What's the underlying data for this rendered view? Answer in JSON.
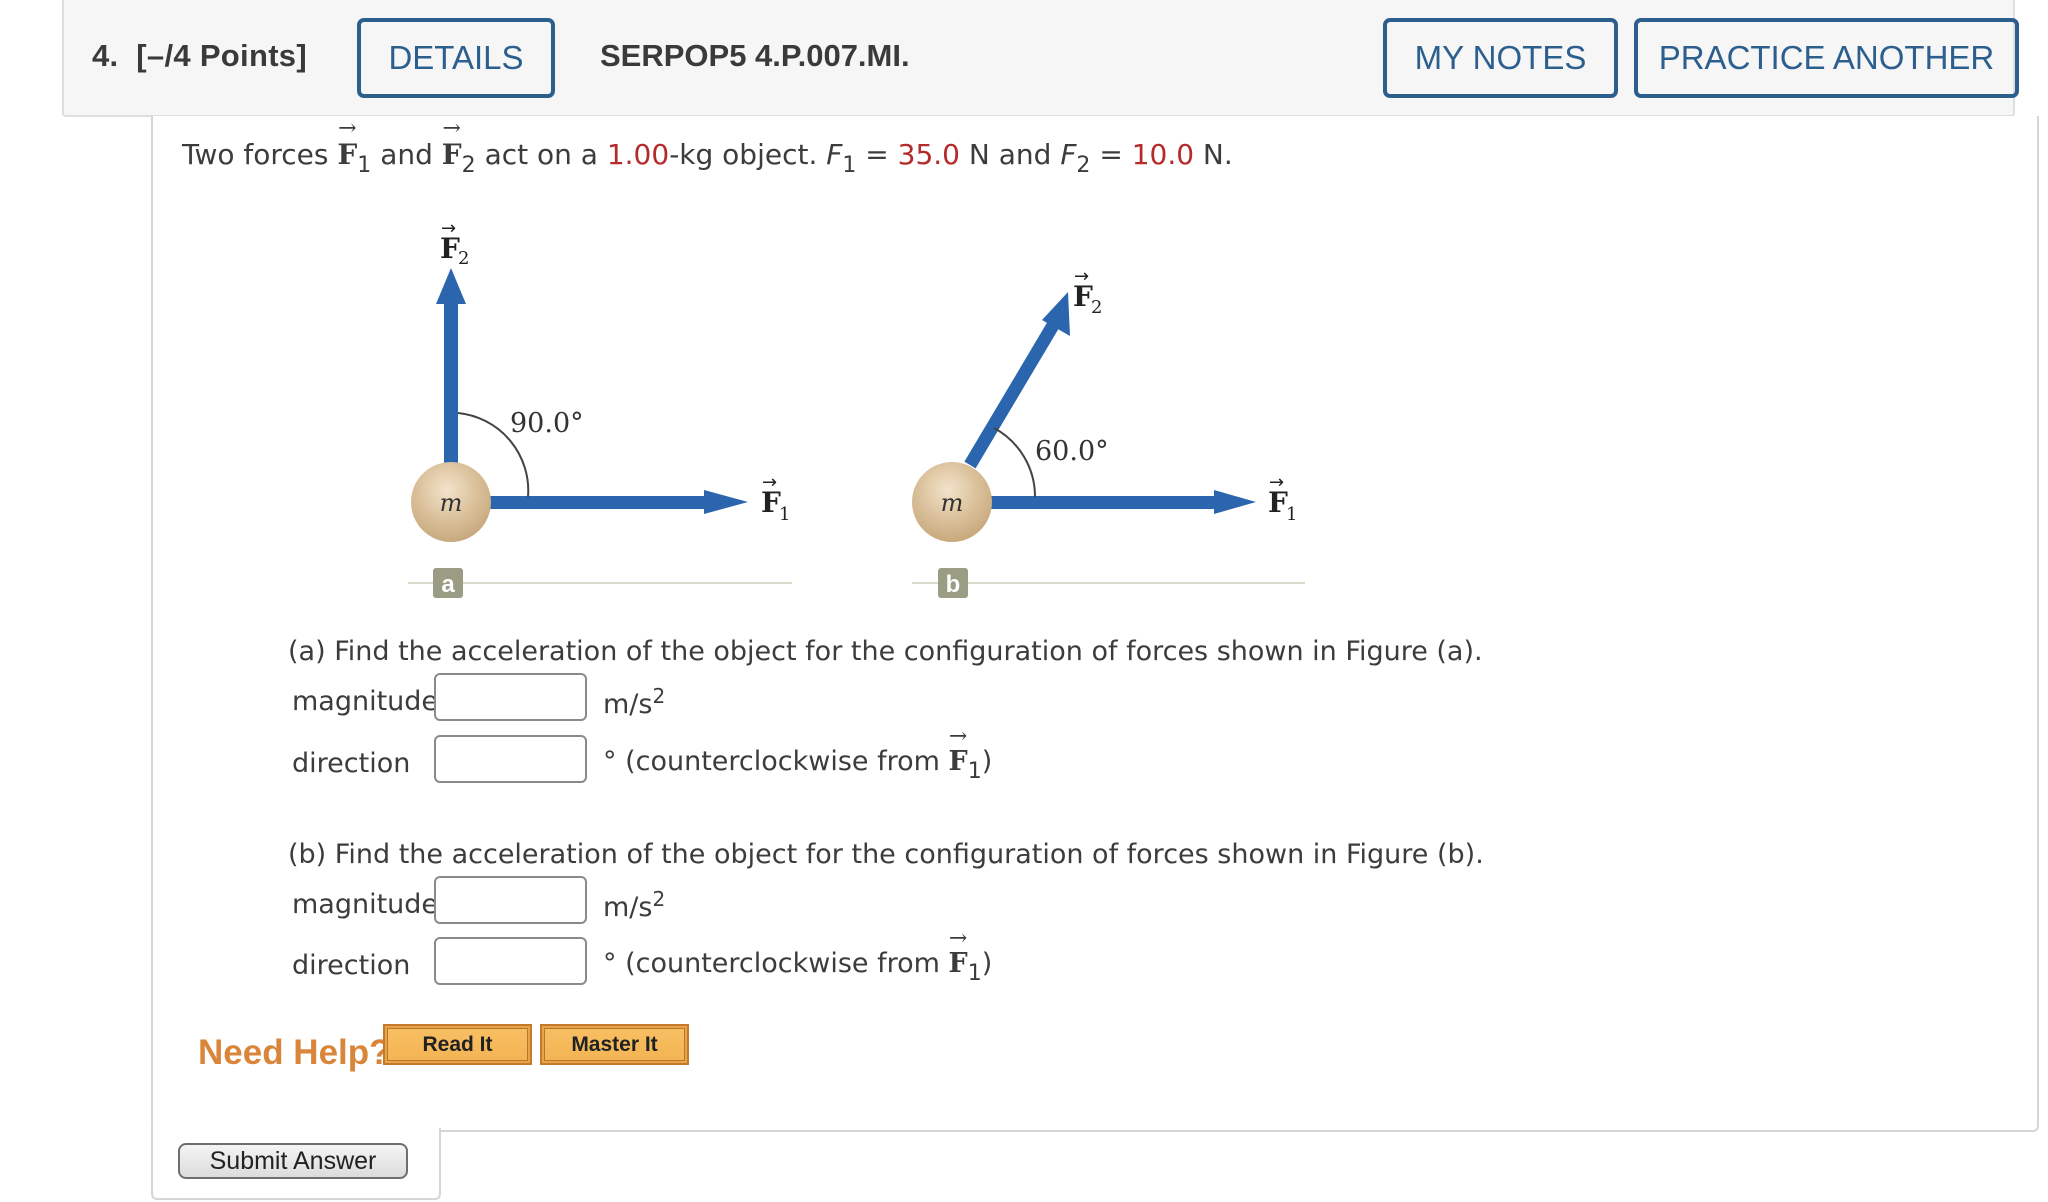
{
  "header": {
    "question_number": "4.",
    "points": "[–/4 Points]",
    "details_label": "DETAILS",
    "problem_code": "SERPOP5 4.P.007.MI.",
    "my_notes_label": "MY NOTES",
    "practice_another_label": "PRACTICE ANOTHER",
    "accent_color": "#2d5f8e"
  },
  "problem": {
    "t1": "Two forces ",
    "vec_f": "F",
    "sub1": "1",
    "sub2": "2",
    "t2": " and ",
    "t3": " act on a ",
    "mass": "1.00",
    "t4": "-kg object. ",
    "f1_sym": "F",
    "eq": " = ",
    "f1_value": "35.0",
    "t5": " N and ",
    "f2_value": "10.0",
    "t6": " N.",
    "highlight_color": "#b52a2a"
  },
  "figure": {
    "a": {
      "label": "a",
      "angle_label": "90.0°",
      "mass_label": "m",
      "f1_label": "F",
      "f1_sub": "1",
      "f2_label": "F",
      "f2_sub": "2"
    },
    "b": {
      "label": "b",
      "angle_label": "60.0°",
      "mass_label": "m",
      "f1_label": "F",
      "f1_sub": "1",
      "f2_label": "F",
      "f2_sub": "2"
    },
    "arrow_color": "#2a65ad"
  },
  "parts": [
    {
      "question": "(a) Find the acceleration of the object for the configuration of forces shown in Figure (a).",
      "magnitude_label": "magnitude",
      "magnitude_value": "",
      "magnitude_unit": "m/s",
      "magnitude_unit_sup": "2",
      "direction_label": "direction",
      "direction_value": "",
      "direction_unit": "° (counterclockwise from ",
      "direction_vec": "F",
      "direction_vec_sub": "1",
      "direction_close": ")"
    },
    {
      "question": "(b) Find the acceleration of the object for the configuration of forces shown in Figure (b).",
      "magnitude_label": "magnitude",
      "magnitude_value": "",
      "magnitude_unit": "m/s",
      "magnitude_unit_sup": "2",
      "direction_label": "direction",
      "direction_value": "",
      "direction_unit": "° (counterclockwise from ",
      "direction_vec": "F",
      "direction_vec_sub": "1",
      "direction_close": ")"
    }
  ],
  "help": {
    "label": "Need Help?",
    "read_it": "Read It",
    "master_it": "Master It",
    "color": "#d9853a"
  },
  "submit_label": "Submit Answer"
}
